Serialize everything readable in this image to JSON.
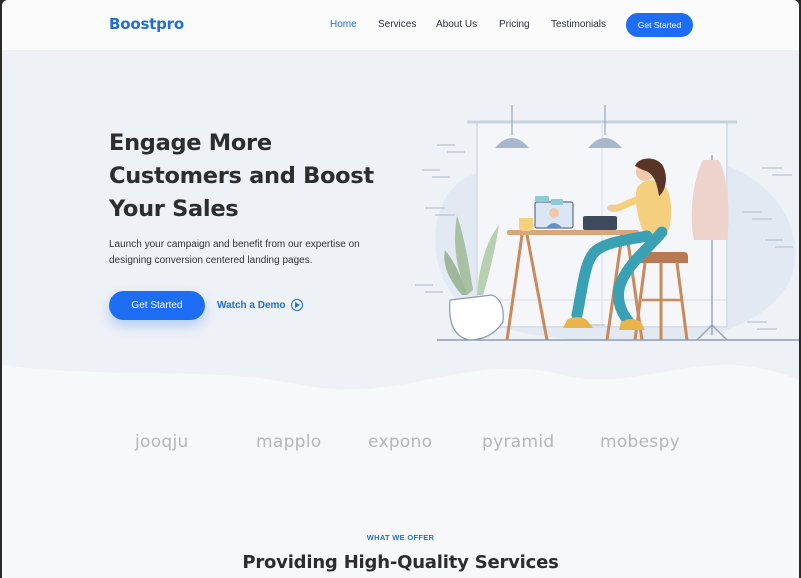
{
  "header": {
    "logo": "Boostpro",
    "nav": [
      {
        "label": "Home",
        "active": true
      },
      {
        "label": "Services",
        "active": false
      },
      {
        "label": "About Us",
        "active": false
      },
      {
        "label": "Pricing",
        "active": false
      },
      {
        "label": "Testimonials",
        "active": false
      }
    ],
    "cta_label": "Get Started"
  },
  "hero": {
    "title_lines": [
      "Engage More",
      "Customers and Boost",
      "Your Sales"
    ],
    "subtitle": "Launch your campaign and benefit from our expertise on designing conversion centered landing pages.",
    "primary_button": "Get Started",
    "demo_link": "Watch a Demo"
  },
  "brands": [
    "jooqju",
    "mapplo",
    "expono",
    "pyramid",
    "mobespy"
  ],
  "offer": {
    "label": "WHAT WE OFFER",
    "title": "Providing High-Quality Services"
  },
  "colors": {
    "accent": "#1d6ef5",
    "text_dark": "#2d2d2f",
    "brand_gray": "#b3b6ba"
  },
  "icons": [
    "play-icon"
  ]
}
